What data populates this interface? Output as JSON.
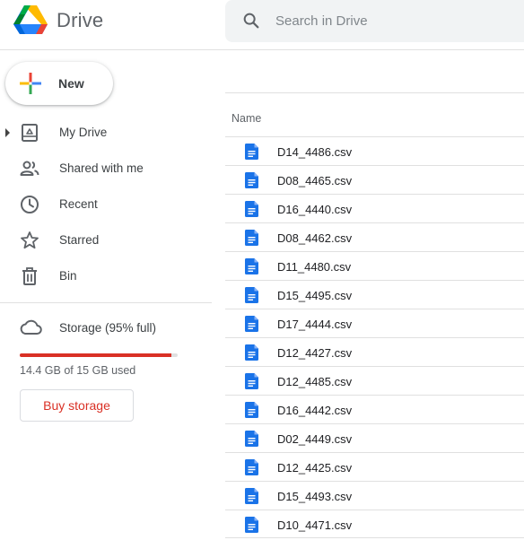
{
  "header": {
    "brand": "Drive",
    "search_placeholder": "Search in Drive"
  },
  "new_button": {
    "label": "New"
  },
  "sidebar": {
    "items": [
      {
        "label": "My Drive",
        "icon": "my-drive-icon"
      },
      {
        "label": "Shared with me",
        "icon": "shared-icon"
      },
      {
        "label": "Recent",
        "icon": "clock-icon"
      },
      {
        "label": "Starred",
        "icon": "star-icon"
      },
      {
        "label": "Bin",
        "icon": "trash-icon"
      }
    ],
    "storage": {
      "label": "Storage (95% full)",
      "used_text": "14.4 GB of 15 GB used",
      "used_fraction": 0.96,
      "bar_color": "#d93025",
      "buy_label": "Buy storage"
    }
  },
  "file_list": {
    "column_header": "Name",
    "files": [
      "D14_4486.csv",
      "D08_4465.csv",
      "D16_4440.csv",
      "D08_4462.csv",
      "D11_4480.csv",
      "D15_4495.csv",
      "D17_4444.csv",
      "D12_4427.csv",
      "D12_4485.csv",
      "D16_4442.csv",
      "D02_4449.csv",
      "D12_4425.csv",
      "D15_4493.csv",
      "D10_4471.csv"
    ]
  },
  "colors": {
    "accent_blue": "#4285f4",
    "doc_icon_blue": "#1a73e8",
    "warning_red": "#d93025"
  }
}
